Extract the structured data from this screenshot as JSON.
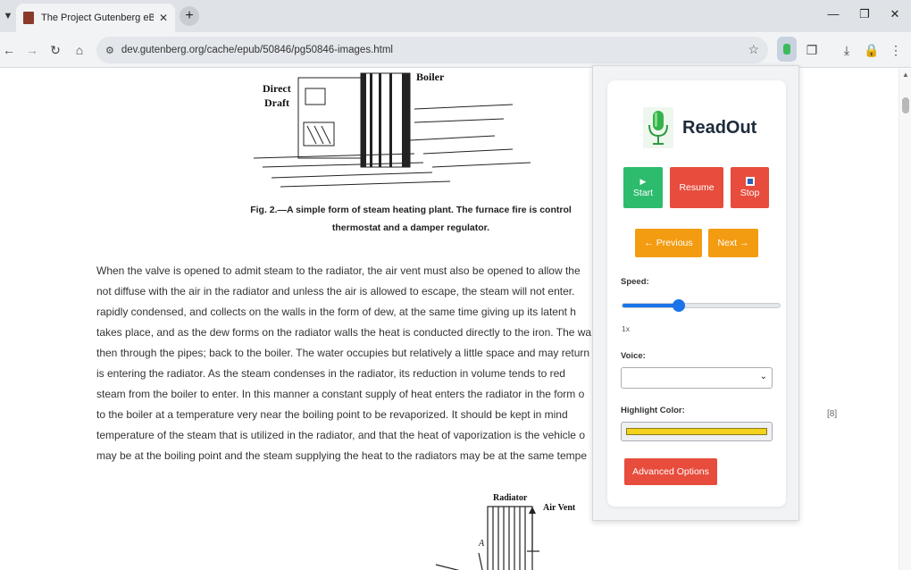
{
  "browser": {
    "tab_title": "The Project Gutenberg eBook o",
    "url": "dev.gutenberg.org/cache/epub/50846/pg50846-images.html"
  },
  "page": {
    "figure_top_labels": [
      "Direct",
      "Draft",
      "Boiler"
    ],
    "caption_line1": "Fig. 2.—A simple form of steam heating plant. The furnace fire is control",
    "caption_line2": "thermostat and a damper regulator.",
    "paragraph": [
      "When the valve is opened to admit steam to the radiator, the air vent must also be opened to allow the",
      "not diffuse with the air in the radiator and unless the air is allowed to escape, the steam will not enter.",
      "rapidly condensed, and collects on the walls in the form of dew, at the same time giving up its latent h",
      "takes place, and as the dew forms on the radiator walls the heat is conducted directly to the iron. The wa",
      "then through the pipes; back to the boiler. The water occupies but relatively a little space and may return",
      "is entering the radiator. As the steam condenses in the radiator, its reduction in volume tends to red",
      "steam from the boiler to enter. In this manner a constant supply of heat enters the radiator in the form o",
      "to the boiler at a temperature very near the boiling point to be revaporized. It should be kept in mind",
      "temperature of the steam that is utilized in the radiator, and that the heat of vaporization is the vehicle o",
      "may be at the boiling point and the steam supplying the heat to the radiators may be at the same tempe"
    ],
    "page_number": "[8]",
    "figure_bottom_labels": [
      "Radiator",
      "Air Vent",
      "A"
    ]
  },
  "extension": {
    "name": "ReadOut",
    "start_label": "Start",
    "resume_label": "Resume",
    "stop_label": "Stop",
    "previous_label": "← Previous",
    "next_label": "Next →",
    "speed_label": "Speed:",
    "speed_value": "1x",
    "speed_fraction": 0.36,
    "voice_label": "Voice:",
    "voice_selected": "",
    "highlight_label": "Highlight Color:",
    "highlight_color": "#f2d21b",
    "advanced_label": "Advanced Options",
    "colors": {
      "green": "#2dbb6d",
      "red": "#e74c3c",
      "orange": "#f39c12",
      "slider": "#1a73e8"
    }
  },
  "icons": [
    "tab-list-icon",
    "close-tab-icon",
    "new-tab-icon",
    "minimize-icon",
    "maximize-icon",
    "close-window-icon",
    "back-icon",
    "forward-icon",
    "reload-icon",
    "home-icon",
    "site-info-icon",
    "star-icon",
    "extensions-icon",
    "download-icon",
    "lock-icon",
    "menu-icon",
    "microphone-icon"
  ]
}
